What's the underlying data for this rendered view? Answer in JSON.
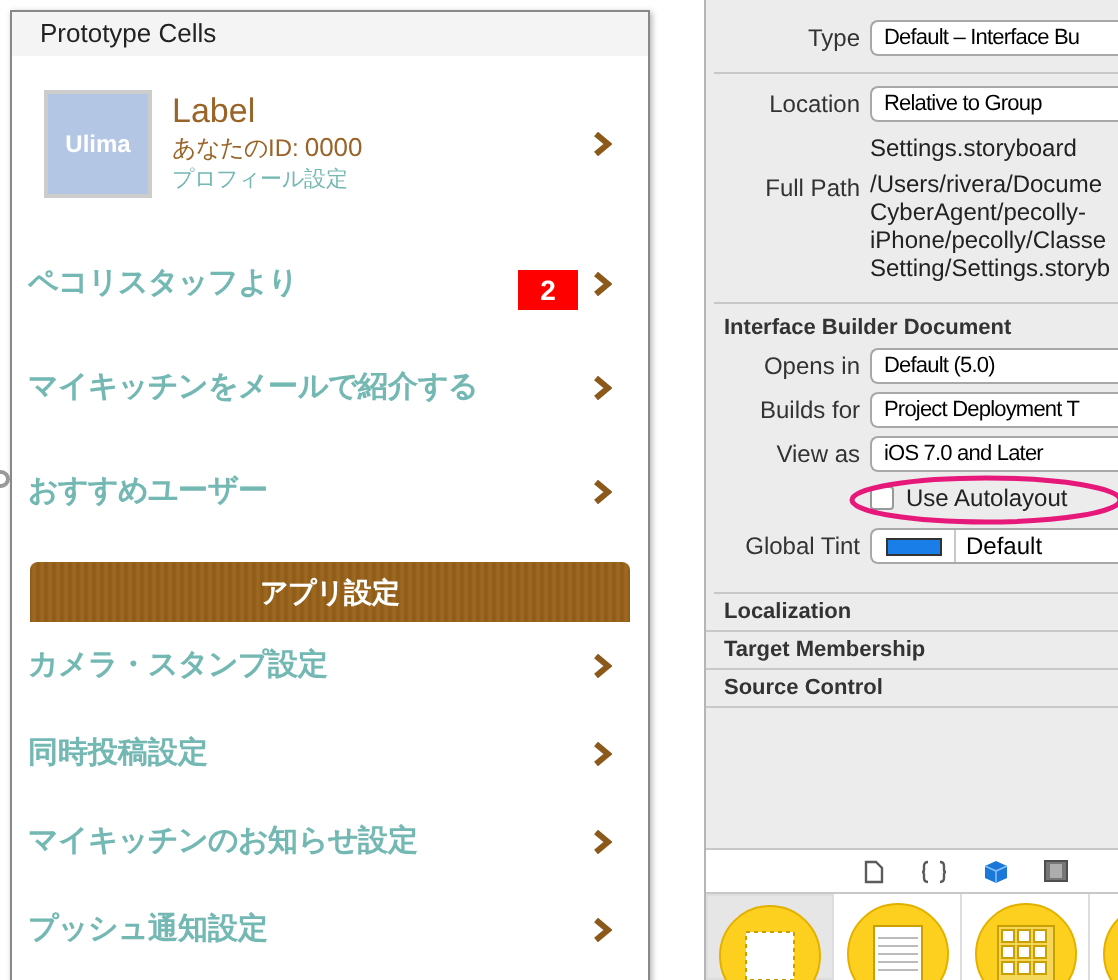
{
  "storyboard": {
    "title": "Prototype Cells",
    "profile": {
      "avatar_text": "Ulima",
      "name": "Label",
      "id_label": "あなたのID:",
      "id_value": "0000",
      "link": "プロフィール設定"
    },
    "rows": [
      {
        "label": "ペコリスタッフより",
        "badge": "2"
      },
      {
        "label": "マイキッチンをメールで紹介する"
      },
      {
        "label": "おすすめユーザー"
      }
    ],
    "section_header": "アプリ設定",
    "settings_rows": [
      {
        "label": "カメラ・スタンプ設定"
      },
      {
        "label": "同時投稿設定"
      },
      {
        "label": "マイキッチンのお知らせ設定"
      },
      {
        "label": "プッシュ通知設定"
      }
    ]
  },
  "inspector": {
    "file_fields": [
      {
        "kind": "popup",
        "label": "Type",
        "value": "Default – Interface Bu"
      },
      {
        "kind": "popup",
        "label": "Location",
        "value": "Relative to Group"
      },
      {
        "kind": "text",
        "value": "Settings.storyboard"
      },
      {
        "kind": "path",
        "label": "Full Path",
        "lines": [
          "/Users/rivera/Docume",
          "CyberAgent/pecolly-",
          "iPhone/pecolly/Classe",
          "Setting/Settings.storyb"
        ]
      }
    ],
    "ib_section": {
      "title": "Interface Builder Document",
      "fields": [
        {
          "kind": "popup",
          "label": "Opens in",
          "value": "Default (5.0)"
        },
        {
          "kind": "popup",
          "label": "Builds for",
          "value": "Project Deployment T"
        },
        {
          "kind": "popup",
          "label": "View as",
          "value": "iOS 7.0 and Later"
        },
        {
          "kind": "checkbox",
          "value": "Use Autolayout",
          "checked": false,
          "highlighted": true
        },
        {
          "kind": "color",
          "label": "Global Tint",
          "color": "#1a7ee8",
          "value": "Default"
        }
      ]
    },
    "collapsed_sections": [
      "Localization",
      "Target Membership",
      "Source Control"
    ],
    "library_tabs": [
      {
        "kind": "file",
        "selected": false
      },
      {
        "kind": "braces",
        "selected": false
      },
      {
        "kind": "cube",
        "selected": true
      },
      {
        "kind": "film",
        "selected": false
      }
    ],
    "library_items": [
      {
        "kind": "view",
        "selected": true
      },
      {
        "kind": "table",
        "selected": false
      },
      {
        "kind": "grid",
        "selected": false
      },
      {
        "kind": "partial",
        "selected": false
      }
    ]
  }
}
